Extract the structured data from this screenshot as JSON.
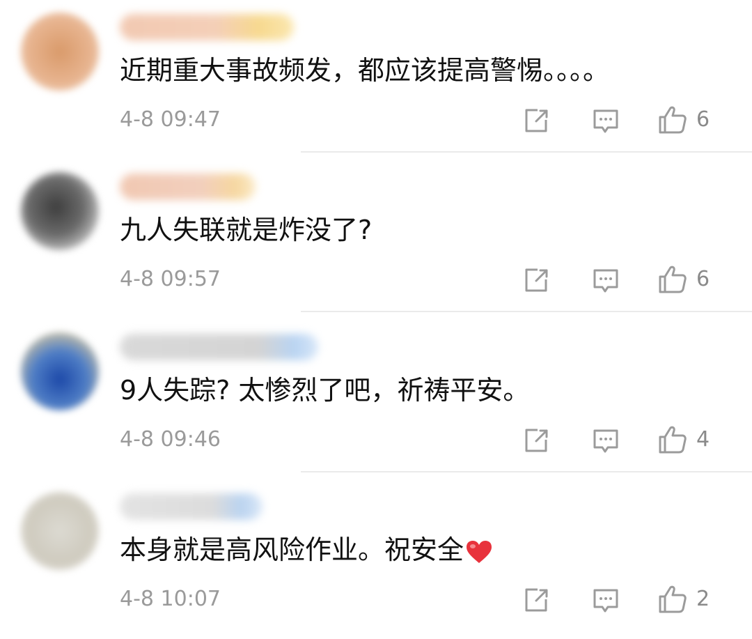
{
  "comments": [
    {
      "text": "近期重大事故频发，都应该提高警惕。。。。",
      "time": "4-8 09:47",
      "likes": "6"
    },
    {
      "text": "九人失联就是炸没了?",
      "time": "4-8 09:57",
      "likes": "6"
    },
    {
      "text": "9人失踪? 太惨烈了吧，祈祷平安。",
      "time": "4-8 09:46",
      "likes": "4"
    },
    {
      "text": "本身就是高风险作业。祝安全",
      "time": "4-8 10:07",
      "likes": "2"
    }
  ],
  "icons": {
    "share": "share-icon",
    "reply": "reply-icon",
    "like": "thumbs-up-icon",
    "heart": "heart-emoji-icon"
  },
  "colors": {
    "text": "#111111",
    "meta": "#9a9a9a",
    "icon": "#9b9b9b",
    "heart": "#e8323c"
  }
}
